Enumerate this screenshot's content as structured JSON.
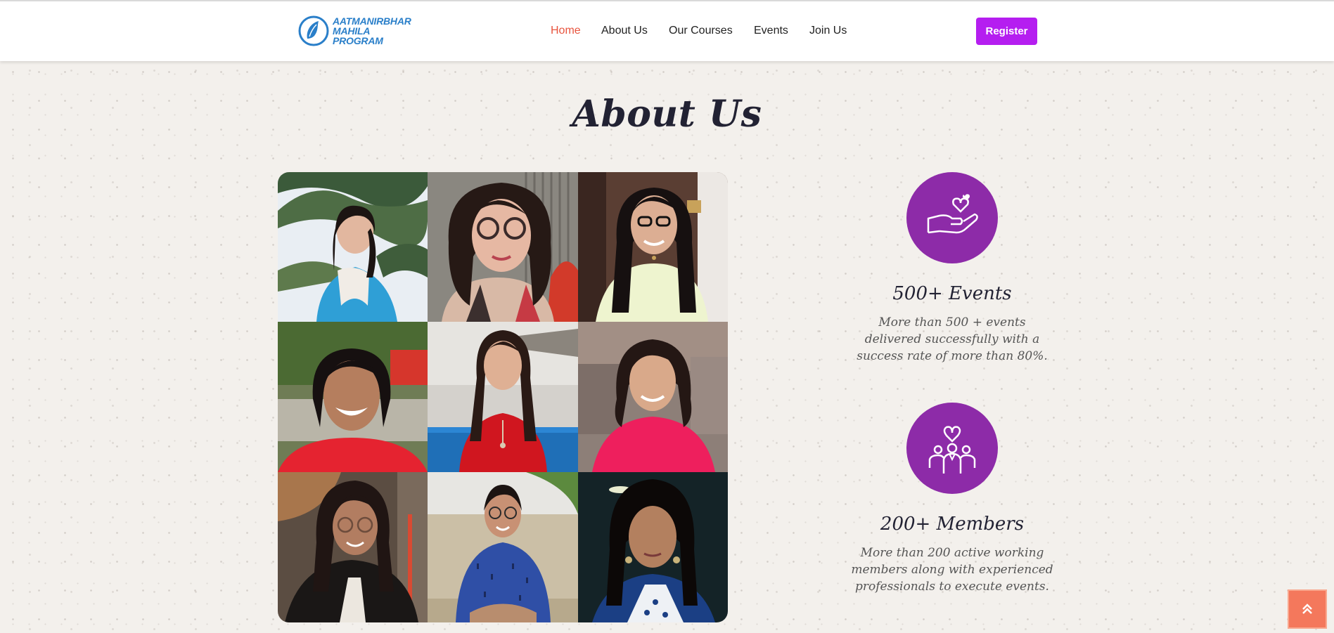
{
  "brand": {
    "line1": "AATMANIRBHAR",
    "line2": "MAHILA",
    "line3": "PROGRAM",
    "color": "#2a7fc9"
  },
  "nav": {
    "items": [
      {
        "label": "Home",
        "active": true
      },
      {
        "label": "About Us",
        "active": false
      },
      {
        "label": "Our Courses",
        "active": false
      },
      {
        "label": "Events",
        "active": false
      },
      {
        "label": "Join Us",
        "active": false
      }
    ],
    "active_color": "#e8543e"
  },
  "register": {
    "label": "Register",
    "color": "#b51ef0"
  },
  "section": {
    "title": "About Us"
  },
  "gallery": {
    "photos": [
      {
        "name": "woman-in-snow"
      },
      {
        "name": "woman-with-glasses"
      },
      {
        "name": "woman-smiling-indoor"
      },
      {
        "name": "woman-red-top-outdoor"
      },
      {
        "name": "woman-red-dress-riverside"
      },
      {
        "name": "woman-pink-top"
      },
      {
        "name": "woman-black-blazer"
      },
      {
        "name": "woman-blue-top-seated"
      },
      {
        "name": "woman-night-portrait"
      }
    ]
  },
  "stats": [
    {
      "icon": "hand-heart-icon",
      "title": "500+ Events",
      "description": "More than 500 + events delivered successfully with a success rate of more than 80%."
    },
    {
      "icon": "team-heart-icon",
      "title": "200+ Members",
      "description": "More than 200 active working members along with experienced professionals to execute events."
    }
  ],
  "accent_colors": {
    "icon_circle": "#8d2ba8",
    "scroll_top": "#f4785c"
  },
  "scroll_top_icon": "chevron-up-double-icon"
}
